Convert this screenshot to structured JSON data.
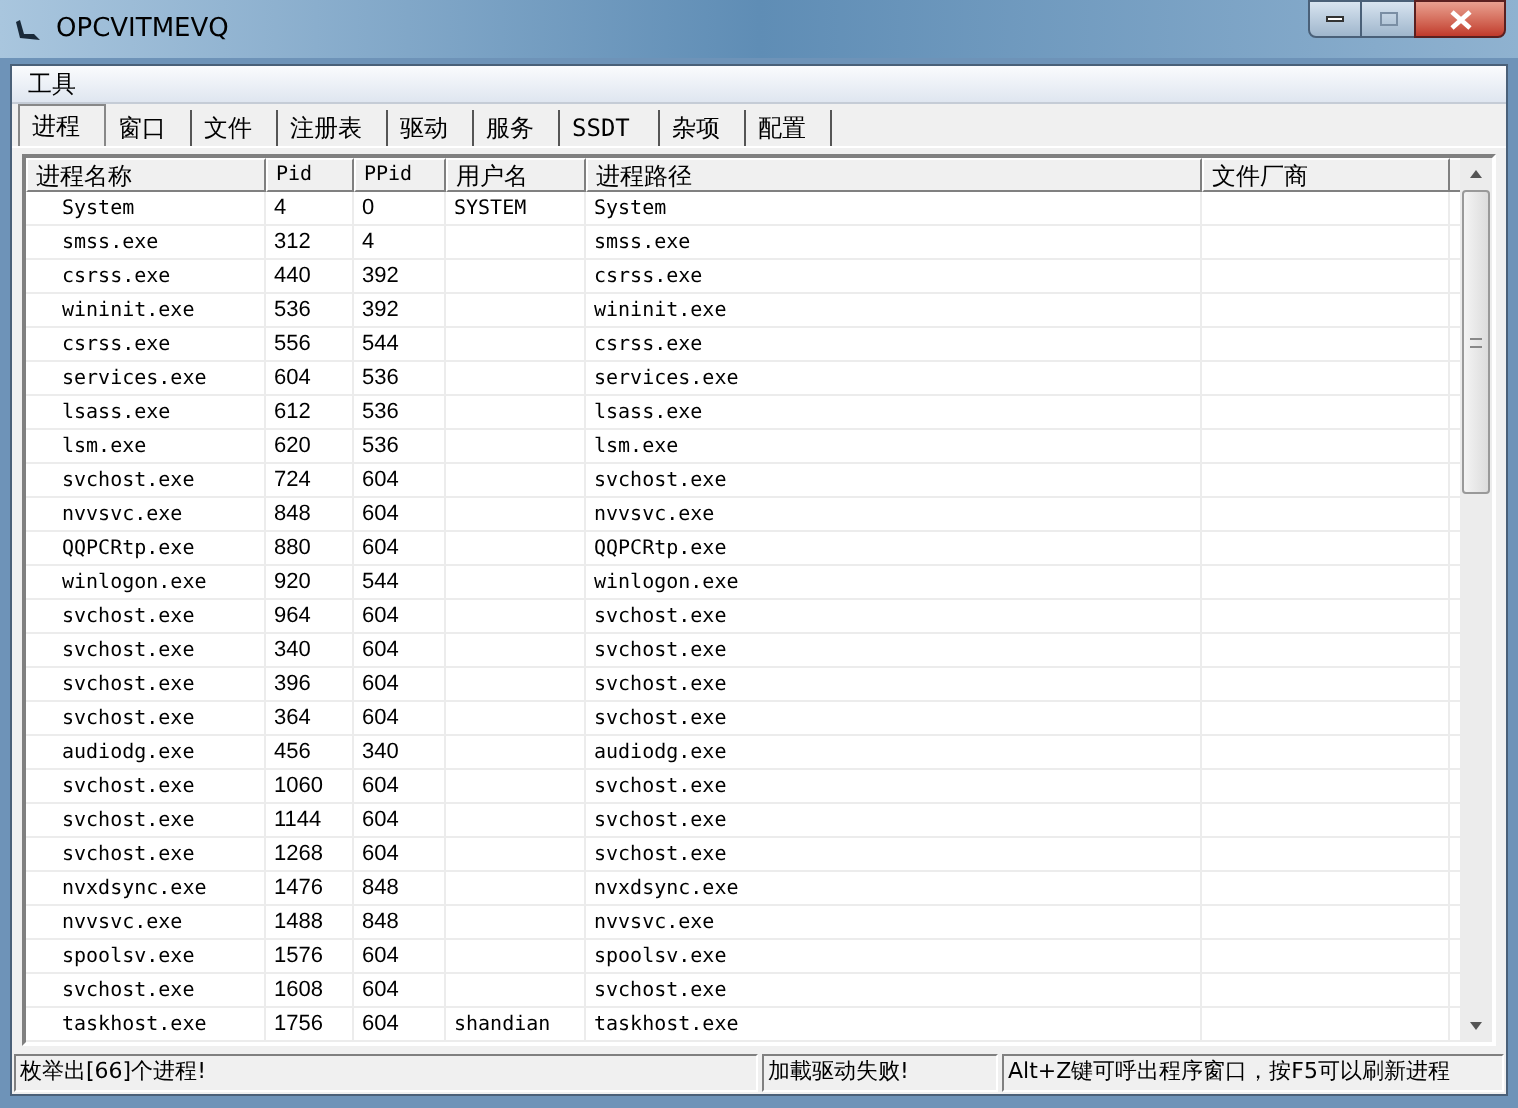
{
  "window": {
    "title": "OPCVITMEVQ"
  },
  "menu": [
    "工具"
  ],
  "tabs": [
    {
      "label": "进程",
      "selected": true
    },
    {
      "label": "窗口",
      "selected": false
    },
    {
      "label": "文件",
      "selected": false
    },
    {
      "label": "注册表",
      "selected": false
    },
    {
      "label": "驱动",
      "selected": false
    },
    {
      "label": "服务",
      "selected": false
    },
    {
      "label": "SSDT",
      "selected": false
    },
    {
      "label": "杂项",
      "selected": false
    },
    {
      "label": "配置",
      "selected": false
    }
  ],
  "table": {
    "columns": [
      "进程名称",
      "Pid",
      "PPid",
      "用户名",
      "进程路径",
      "文件厂商"
    ],
    "rows": [
      [
        "System",
        "4",
        "0",
        "SYSTEM",
        "System"
      ],
      [
        "smss.exe",
        "312",
        "4",
        "",
        "smss.exe"
      ],
      [
        "csrss.exe",
        "440",
        "392",
        "",
        "csrss.exe"
      ],
      [
        "wininit.exe",
        "536",
        "392",
        "",
        "wininit.exe"
      ],
      [
        "csrss.exe",
        "556",
        "544",
        "",
        "csrss.exe"
      ],
      [
        "services.exe",
        "604",
        "536",
        "",
        "services.exe"
      ],
      [
        "lsass.exe",
        "612",
        "536",
        "",
        "lsass.exe"
      ],
      [
        "lsm.exe",
        "620",
        "536",
        "",
        "lsm.exe"
      ],
      [
        "svchost.exe",
        "724",
        "604",
        "",
        "svchost.exe"
      ],
      [
        "nvvsvc.exe",
        "848",
        "604",
        "",
        "nvvsvc.exe"
      ],
      [
        "QQPCRtp.exe",
        "880",
        "604",
        "",
        "QQPCRtp.exe"
      ],
      [
        "winlogon.exe",
        "920",
        "544",
        "",
        "winlogon.exe"
      ],
      [
        "svchost.exe",
        "964",
        "604",
        "",
        "svchost.exe"
      ],
      [
        "svchost.exe",
        "340",
        "604",
        "",
        "svchost.exe"
      ],
      [
        "svchost.exe",
        "396",
        "604",
        "",
        "svchost.exe"
      ],
      [
        "svchost.exe",
        "364",
        "604",
        "",
        "svchost.exe"
      ],
      [
        "audiodg.exe",
        "456",
        "340",
        "",
        "audiodg.exe"
      ],
      [
        "svchost.exe",
        "1060",
        "604",
        "",
        "svchost.exe"
      ],
      [
        "svchost.exe",
        "1144",
        "604",
        "",
        "svchost.exe"
      ],
      [
        "svchost.exe",
        "1268",
        "604",
        "",
        "svchost.exe"
      ],
      [
        "nvxdsync.exe",
        "1476",
        "848",
        "",
        "nvxdsync.exe"
      ],
      [
        "nvvsvc.exe",
        "1488",
        "848",
        "",
        "nvvsvc.exe"
      ],
      [
        "spoolsv.exe",
        "1576",
        "604",
        "",
        "spoolsv.exe"
      ],
      [
        "svchost.exe",
        "1608",
        "604",
        "",
        "svchost.exe"
      ],
      [
        "taskhost.exe",
        "1756",
        "604",
        "shandian",
        "taskhost.exe"
      ]
    ]
  },
  "status_bar": [
    "枚举出[66]个进程!",
    "加載驱动失败!",
    "Alt+Z键可呼出程序窗口，按F5可以刷新进程"
  ]
}
